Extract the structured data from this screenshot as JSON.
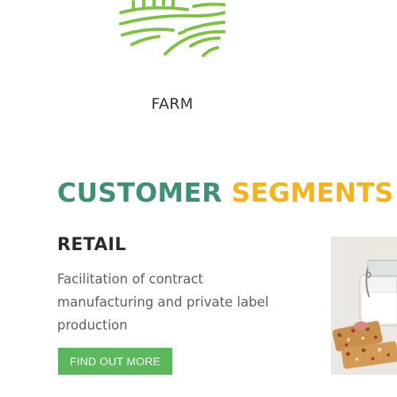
{
  "farm": {
    "icon": "farm-fields-icon",
    "label": "FARM"
  },
  "segments": {
    "title_part1": "CUSTOMER",
    "title_part2": "SEGMENTS"
  },
  "retail": {
    "heading": "RETAIL",
    "description": "Facilitation of contract manufacturing and private label production",
    "button_label": "FIND OUT MORE"
  },
  "product_image": {
    "icon": "jar-and-granola-bars-photo"
  },
  "colors": {
    "accent_green": "#5cb85c",
    "icon_green": "#7cc243",
    "title_teal": "#3f8f73",
    "title_yellow": "#f4b221",
    "heading_dark": "#2b2b2b",
    "body_gray": "#5f5f5f"
  }
}
